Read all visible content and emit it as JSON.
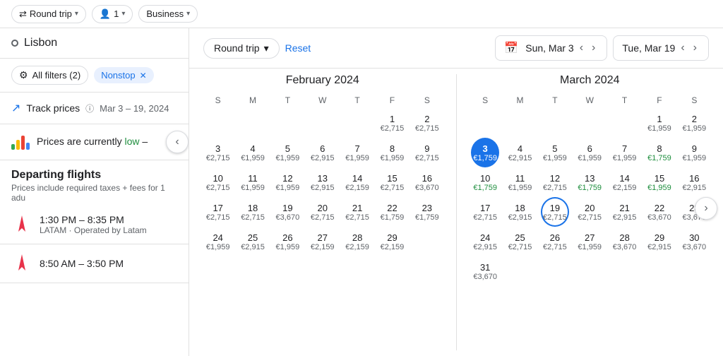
{
  "topBar": {
    "tripType": "Round trip",
    "passengers": "1",
    "class": "Business"
  },
  "leftPanel": {
    "destination": "Lisbon",
    "filtersLabel": "All filters (2)",
    "nonstopLabel": "Nonstop",
    "trackLabel": "Track prices",
    "trackInfo": "ⓘ",
    "trackDates": "Mar 3 – 19, 2024",
    "priceBanner": "Prices are currently low –",
    "priceLow": "low",
    "flightsTitle": "Departing flights",
    "flightsSubtitle": "Prices include required taxes + fees for 1 adu",
    "flights": [
      {
        "time": "1:30 PM – 8:35 PM",
        "carrier": "LATAM · Operated by Latam"
      },
      {
        "time": "8:50 AM – 3:50 PM",
        "carrier": ""
      }
    ]
  },
  "calendar": {
    "tripType": "Round trip",
    "resetLabel": "Reset",
    "startDate": "Sun, Mar 3",
    "endDate": "Tue, Mar 19",
    "february": {
      "title": "February 2024",
      "days": [
        "S",
        "M",
        "T",
        "W",
        "T",
        "F",
        "S"
      ],
      "weeks": [
        [
          null,
          null,
          null,
          null,
          null,
          "1\n€2,715",
          "2\n€2,715"
        ],
        [
          "3\n€2,715",
          "4\n€1,959",
          "5\n€1,959",
          "6\n€2,915",
          "7\n€1,959",
          "8\n€1,959",
          "9\n€2,715"
        ],
        [
          "10\n€2,715",
          "11\n€1,959",
          "12\n€1,959",
          "13\n€2,915",
          "14\n€2,159",
          "15\n€2,715",
          "16\n€3,670"
        ],
        [
          "17\n€2,715",
          "18\n€2,715",
          "19\n€3,670",
          "20\n€2,715",
          "21\n€2,715",
          "22\n€1,759",
          "23\n€1,759"
        ],
        [
          "24\n€1,959",
          "25\n€2,915",
          "26\n€1,959",
          "27\n€2,159",
          "28\n€2,159",
          "29\n€2,159",
          null
        ]
      ]
    },
    "march": {
      "title": "March 2024",
      "days": [
        "S",
        "M",
        "T",
        "W",
        "T",
        "F",
        "S"
      ],
      "weeks": [
        [
          null,
          null,
          null,
          null,
          null,
          "1\n€1,959",
          "2\n€1,959"
        ],
        [
          "3\n€1,759",
          "4\n€2,915",
          "5\n€1,959",
          "6\n€1,959",
          "7\n€1,959",
          "8\n€1,759",
          "9\n€1,959"
        ],
        [
          "10\n€1,759",
          "11\n€1,959",
          "12\n€2,715",
          "13\n€1,759",
          "14\n€2,159",
          "15\n€1,959",
          "16\n€2,915"
        ],
        [
          "17\n€2,715",
          "18\n€2,915",
          "19\n€2,715",
          "20\n€2,715",
          "21\n€2,915",
          "22\n€3,670",
          "23\n€3,670"
        ],
        [
          "24\n€2,915",
          "25\n€2,715",
          "26\n€2,715",
          "27\n€1,959",
          "28\n€3,670",
          "29\n€2,915",
          "30\n€3,670"
        ],
        [
          "31\n€3,670",
          null,
          null,
          null,
          null,
          null,
          null
        ]
      ]
    }
  },
  "icons": {
    "roundTrip": "⇄",
    "person": "👤",
    "chevronDown": "▾",
    "calendar": "📅",
    "search": "○",
    "filters": "⚙",
    "trending": "↗",
    "leftArrow": "‹",
    "rightArrow": "›"
  }
}
